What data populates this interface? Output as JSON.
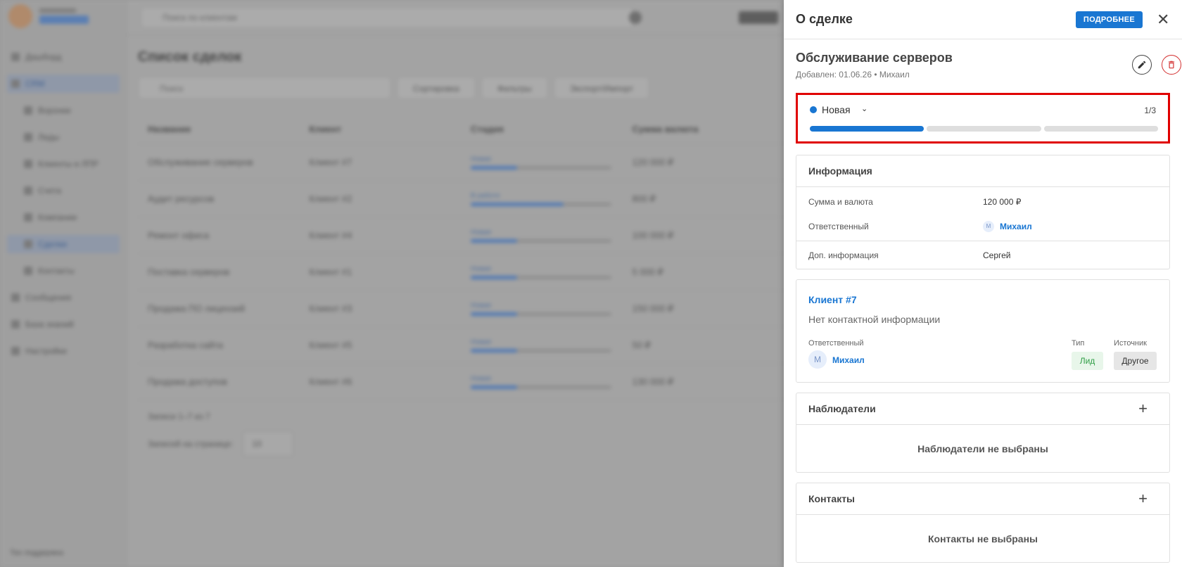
{
  "background": {
    "search_placeholder": "Поиск по клиентам",
    "nav": [
      "Дашборд",
      "CRM",
      "Воронки",
      "Лиды",
      "Клиенты и ЛПР",
      "Счета",
      "Компании",
      "Сделки",
      "Контакты",
      "Сообщения",
      "База знаний",
      "Настройки"
    ],
    "nav_footer": "Тех поддержка",
    "page_title": "Список сделок",
    "filter_placeholder": "Поиск",
    "toolbar": [
      "Сортировка",
      "Фильтры",
      "Экспорт/Импорт"
    ],
    "columns": [
      "Название",
      "Клиент",
      "Стадия",
      "Сумма валюта"
    ],
    "rows": [
      {
        "name": "Обслуживание серверов",
        "client": "Клиент #7",
        "stage": "Новая",
        "progress": 0.33,
        "amount": "120 000 ₽"
      },
      {
        "name": "Аудит ресурсов",
        "client": "Клиент #2",
        "stage": "В работе",
        "progress": 0.66,
        "amount": "800 ₽"
      },
      {
        "name": "Ремонт офиса",
        "client": "Клиент #4",
        "stage": "Новая",
        "progress": 0.33,
        "amount": "100 000 ₽"
      },
      {
        "name": "Поставка серверов",
        "client": "Клиент #1",
        "stage": "Новая",
        "progress": 0.33,
        "amount": "5 000 ₽"
      },
      {
        "name": "Продажа ПО лицензий",
        "client": "Клиент #3",
        "stage": "Новая",
        "progress": 0.33,
        "amount": "150 000 ₽"
      },
      {
        "name": "Разработка сайта",
        "client": "Клиент #5",
        "stage": "Новая",
        "progress": 0.33,
        "amount": "50 ₽"
      },
      {
        "name": "Продажа доступов",
        "client": "Клиент #6",
        "stage": "Новая",
        "progress": 0.33,
        "amount": "130 000 ₽"
      }
    ],
    "pager": "Записи 1–7 из 7",
    "per_page_label": "Записей на странице:",
    "per_page_value": "10"
  },
  "drawer": {
    "title": "О сделке",
    "more_label": "ПОДРОБНЕЕ",
    "close_glyph": "✕",
    "deal_title": "Обслуживание серверов",
    "deal_meta": "Добавлен: 01.06.26 • Михаил",
    "stage": {
      "name": "Новая",
      "chevron": "⌄",
      "counter": "1/3",
      "current": 1,
      "total": 3
    },
    "info": {
      "title": "Информация",
      "rows": [
        {
          "label": "Сумма и валюта",
          "value": "120 000 ₽"
        },
        {
          "label": "Ответственный",
          "value": "Михаил",
          "avatar": "М"
        },
        {
          "label": "Доп. информация",
          "value": "Сергей"
        }
      ]
    },
    "client": {
      "title": "Клиент #7",
      "no_contact": "Нет контактной информации",
      "manager_label": "Ответственный",
      "manager_name": "Михаил",
      "manager_avatar": "М",
      "type_label": "Тип",
      "type_value": "Лид",
      "source_label": "Источник",
      "source_value": "Другое"
    },
    "watchers": {
      "title": "Наблюдатели",
      "empty": "Наблюдатели не выбраны",
      "plus": "+"
    },
    "contacts": {
      "title": "Контакты",
      "empty": "Контакты не выбраны",
      "plus": "+"
    }
  },
  "colors": {
    "accent": "#1976d2",
    "danger": "#d32f2f",
    "highlight": "#e00000",
    "success": "#2e9e45"
  }
}
